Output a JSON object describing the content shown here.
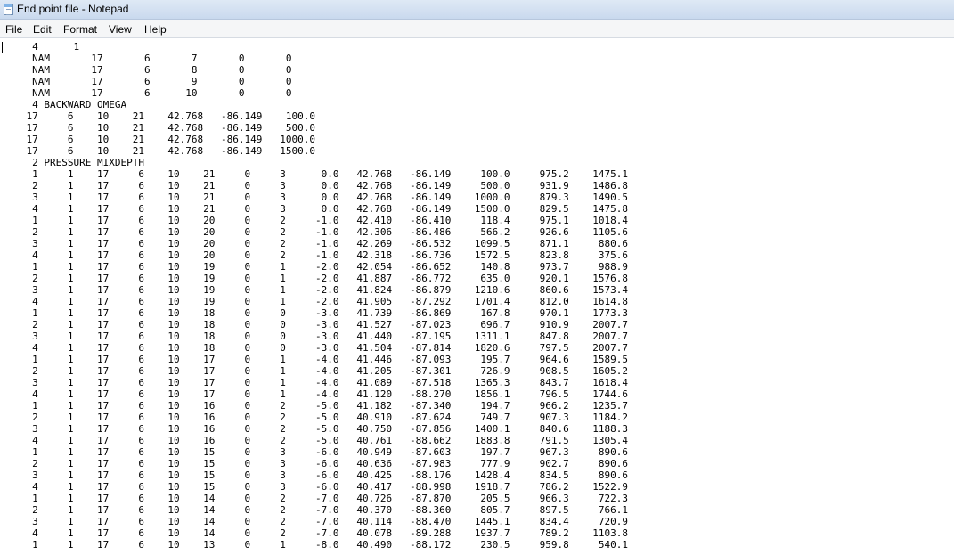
{
  "window": {
    "title": "End point file - Notepad",
    "icon": "notepad-icon"
  },
  "menu": {
    "items": [
      "File",
      "Edit",
      "Format",
      "View",
      "Help"
    ]
  },
  "document": {
    "lines": [
      "     4      1",
      "     NAM       17       6       7       0       0",
      "     NAM       17       6       8       0       0",
      "     NAM       17       6       9       0       0",
      "     NAM       17       6      10       0       0",
      "     4 BACKWARD OMEGA",
      "    17     6    10    21    42.768   -86.149    100.0",
      "    17     6    10    21    42.768   -86.149    500.0",
      "    17     6    10    21    42.768   -86.149   1000.0",
      "    17     6    10    21    42.768   -86.149   1500.0",
      "     2 PRESSURE MIXDEPTH",
      "     1     1    17     6    10    21     0     3      0.0   42.768   -86.149     100.0     975.2    1475.1",
      "     2     1    17     6    10    21     0     3      0.0   42.768   -86.149     500.0     931.9    1486.8",
      "     3     1    17     6    10    21     0     3      0.0   42.768   -86.149    1000.0     879.3    1490.5",
      "     4     1    17     6    10    21     0     3      0.0   42.768   -86.149    1500.0     829.5    1475.8",
      "     1     1    17     6    10    20     0     2     -1.0   42.410   -86.410     118.4     975.1    1018.4",
      "     2     1    17     6    10    20     0     2     -1.0   42.306   -86.486     566.2     926.6    1105.6",
      "     3     1    17     6    10    20     0     2     -1.0   42.269   -86.532    1099.5     871.1     880.6",
      "     4     1    17     6    10    20     0     2     -1.0   42.318   -86.736    1572.5     823.8     375.6",
      "     1     1    17     6    10    19     0     1     -2.0   42.054   -86.652     140.8     973.7     988.9",
      "     2     1    17     6    10    19     0     1     -2.0   41.887   -86.772     635.0     920.1    1576.8",
      "     3     1    17     6    10    19     0     1     -2.0   41.824   -86.879    1210.6     860.6    1573.4",
      "     4     1    17     6    10    19     0     1     -2.0   41.905   -87.292    1701.4     812.0    1614.8",
      "     1     1    17     6    10    18     0     0     -3.0   41.739   -86.869     167.8     970.1    1773.3",
      "     2     1    17     6    10    18     0     0     -3.0   41.527   -87.023     696.7     910.9    2007.7",
      "     3     1    17     6    10    18     0     0     -3.0   41.440   -87.195    1311.1     847.8    2007.7",
      "     4     1    17     6    10    18     0     0     -3.0   41.504   -87.814    1820.6     797.5    2007.7",
      "     1     1    17     6    10    17     0     1     -4.0   41.446   -87.093     195.7     964.6    1589.5",
      "     2     1    17     6    10    17     0     1     -4.0   41.205   -87.301     726.9     908.5    1605.2",
      "     3     1    17     6    10    17     0     1     -4.0   41.089   -87.518    1365.3     843.7    1618.4",
      "     4     1    17     6    10    17     0     1     -4.0   41.120   -88.270    1856.1     796.5    1744.6",
      "     1     1    17     6    10    16     0     2     -5.0   41.182   -87.340     194.7     966.2    1235.7",
      "     2     1    17     6    10    16     0     2     -5.0   40.910   -87.624     749.7     907.3    1184.2",
      "     3     1    17     6    10    16     0     2     -5.0   40.750   -87.856    1400.1     840.6    1188.3",
      "     4     1    17     6    10    16     0     2     -5.0   40.761   -88.662    1883.8     791.5    1305.4",
      "     1     1    17     6    10    15     0     3     -6.0   40.949   -87.603     197.7     967.3     890.6",
      "     2     1    17     6    10    15     0     3     -6.0   40.636   -87.983     777.9     902.7     890.6",
      "     3     1    17     6    10    15     0     3     -6.0   40.425   -88.176    1428.4     834.5     890.6",
      "     4     1    17     6    10    15     0     3     -6.0   40.417   -88.998    1918.7     786.2    1522.9",
      "     1     1    17     6    10    14     0     2     -7.0   40.726   -87.870     205.5     966.3     722.3",
      "     2     1    17     6    10    14     0     2     -7.0   40.370   -88.360     805.7     897.5     766.1",
      "     3     1    17     6    10    14     0     2     -7.0   40.114   -88.470    1445.1     834.4     720.9",
      "     4     1    17     6    10    14     0     2     -7.0   40.078   -89.288    1937.7     789.2    1103.8",
      "     1     1    17     6    10    13     0     1     -8.0   40.490   -88.172     230.5     959.8     540.1"
    ]
  }
}
